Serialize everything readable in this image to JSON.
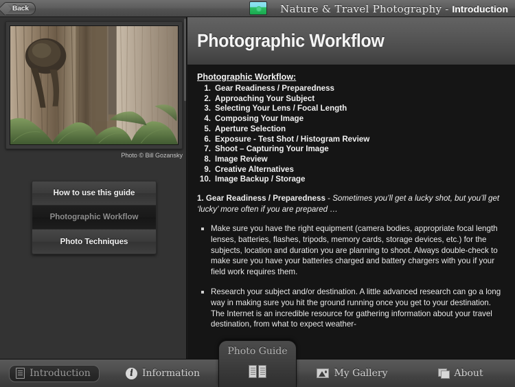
{
  "topbar": {
    "back_label": "Back",
    "logo_icon": "landscape-logo-icon",
    "title_main": "Nature & Travel Photography",
    "title_dash": "-",
    "title_sub": "Introduction"
  },
  "left_panel": {
    "photo_caption": "Photo © Bill Gozansky",
    "photo_alt": "Redwood forest tree trunks with ferns",
    "nav_items": [
      {
        "label": "How to use this guide",
        "selected": false
      },
      {
        "label": "Photographic Workflow",
        "selected": true
      },
      {
        "label": "Photo Techniques",
        "selected": false
      }
    ]
  },
  "content": {
    "header_title": "Photographic Workflow",
    "workflow_heading": "Photographic Workflow:",
    "workflow_items": [
      {
        "num": "1.",
        "label": "Gear Readiness / Preparedness"
      },
      {
        "num": "2.",
        "label": "Approaching Your Subject"
      },
      {
        "num": "3.",
        "label": "Selecting Your Lens / Focal Length"
      },
      {
        "num": "4.",
        "label": "Composing Your Image"
      },
      {
        "num": "5.",
        "label": "Aperture Selection"
      },
      {
        "num": "6.",
        "label": "Exposure - Test Shot / Histogram Review"
      },
      {
        "num": "7.",
        "label": "Shoot – Capturing Your Image"
      },
      {
        "num": "8.",
        "label": "Image Review"
      },
      {
        "num": "9.",
        "label": "Creative Alternatives"
      },
      {
        "num": "10.",
        "label": "Image Backup / Storage"
      }
    ],
    "section_lead": "1. Gear Readiness / Preparedness",
    "section_dash": " - ",
    "section_italic": "Sometimes you’ll get a lucky shot, but you’ll get ‘lucky’ more often if you are prepared …",
    "bullets": [
      "Make sure you have the right equipment (camera bodies, appropriate focal length lenses, batteries, flashes, tripods, memory cards, storage devices, etc.) for the subjects, location and duration you are planning to shoot. Always double-check to make sure you have your batteries charged and battery chargers with you if your field work requires them.",
      "Research your subject and/or destination. A little advanced research can go a long way in making sure you hit the ground running once you get to your destination. The Internet is an incredible resource for gathering information about your travel destination, from what to expect weather-"
    ]
  },
  "tabbar": {
    "tabs": [
      {
        "label": "Introduction",
        "icon": "document-icon",
        "active": true
      },
      {
        "label": "Information",
        "icon": "info-circle-icon",
        "active": false
      },
      {
        "label": "My Gallery",
        "icon": "gallery-image-icon",
        "active": false
      },
      {
        "label": "About",
        "icon": "stacked-cards-icon",
        "active": false
      }
    ],
    "center_tab": {
      "label": "Photo Guide",
      "icon": "open-book-icon"
    }
  },
  "colors": {
    "chrome": "#4e4e4e",
    "panel": "#333333",
    "content_bg": "#151515",
    "text": "#eaeaea"
  }
}
